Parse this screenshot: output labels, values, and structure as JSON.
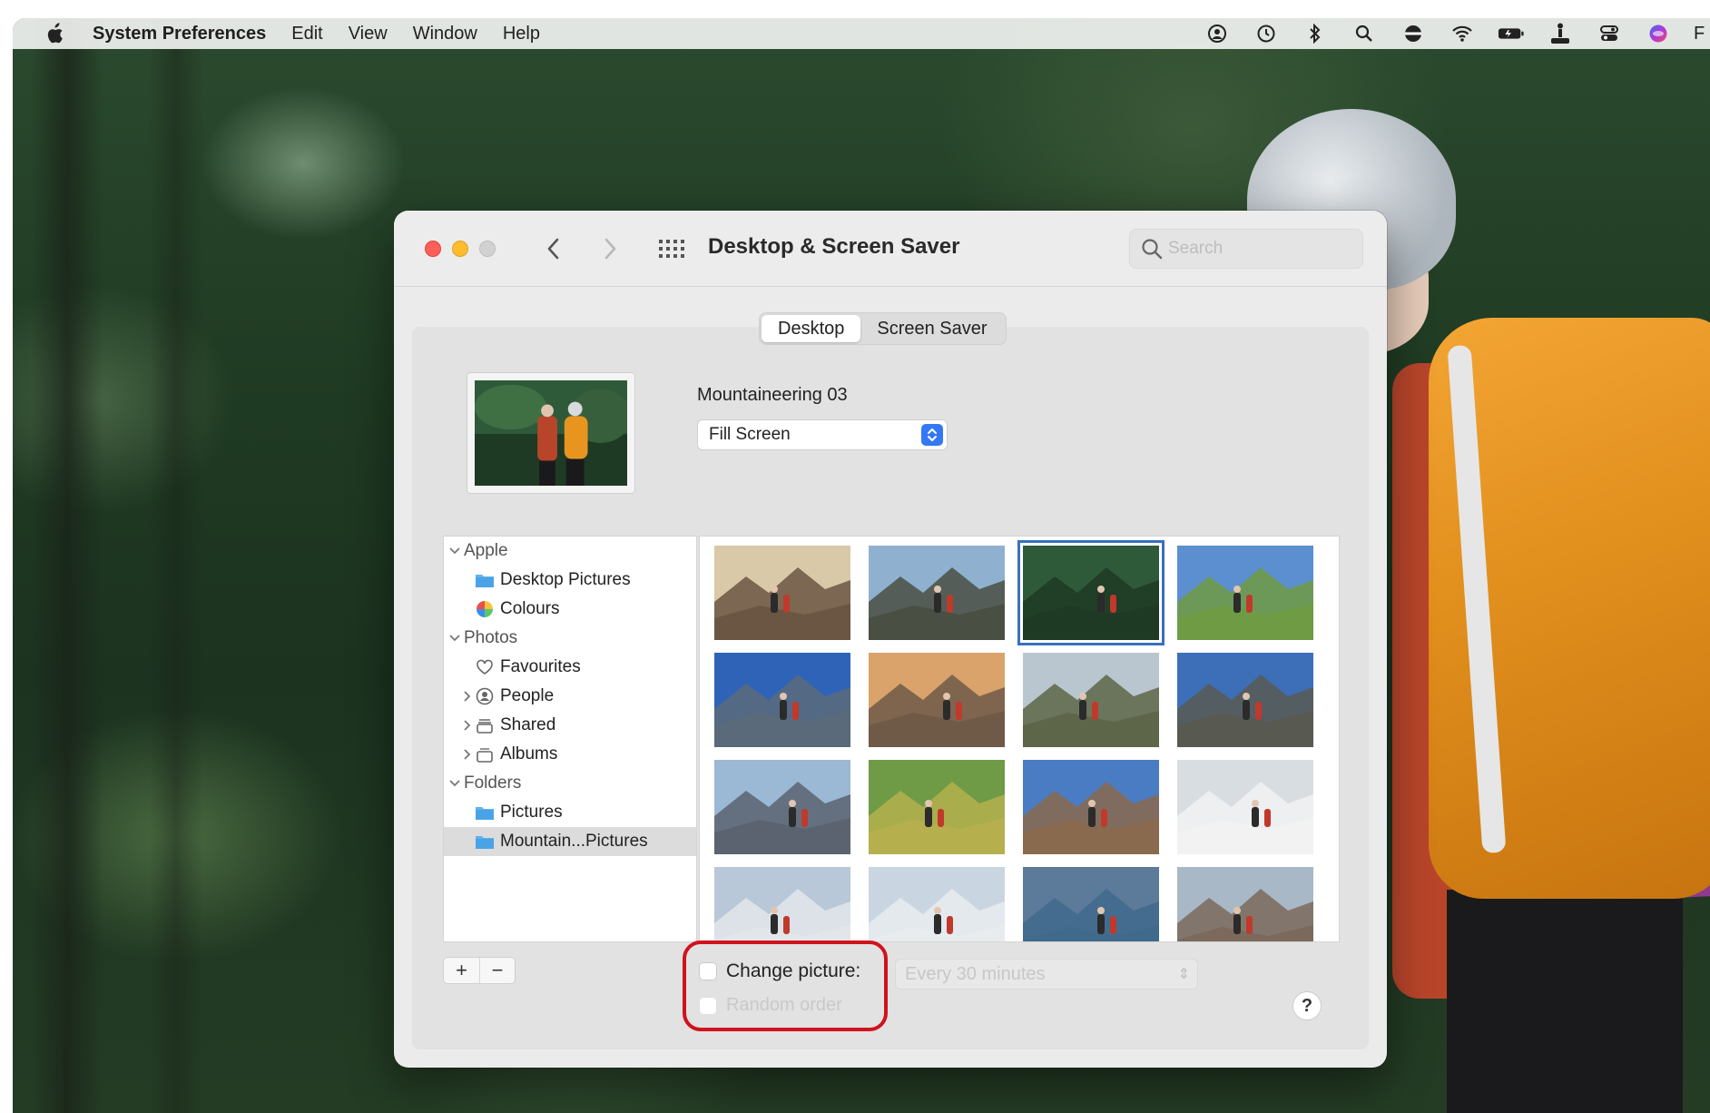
{
  "menubar": {
    "app_name": "System Preferences",
    "items": [
      "Edit",
      "View",
      "Window",
      "Help"
    ],
    "status_icons": [
      "user-switch-icon",
      "time-machine-icon",
      "bluetooth-icon",
      "spotlight-icon",
      "vpn-icon",
      "wifi-icon",
      "battery-icon",
      "accessibility-icon",
      "control-center-icon",
      "siri-icon"
    ],
    "clipped_text": "F"
  },
  "window": {
    "title": "Desktop & Screen Saver",
    "search_placeholder": "Search",
    "tabs": [
      {
        "label": "Desktop",
        "active": true
      },
      {
        "label": "Screen Saver",
        "active": false
      }
    ],
    "wallpaper_name": "Mountaineering 03",
    "fill_mode": "Fill Screen"
  },
  "sources": [
    {
      "label": "Apple",
      "kind": "group",
      "expanded": true
    },
    {
      "label": "Desktop Pictures",
      "kind": "folder",
      "icon": "folder-icon"
    },
    {
      "label": "Colours",
      "kind": "item",
      "icon": "colour-wheel-icon"
    },
    {
      "label": "Photos",
      "kind": "group",
      "expanded": true
    },
    {
      "label": "Favourites",
      "kind": "item",
      "icon": "heart-icon"
    },
    {
      "label": "People",
      "kind": "item",
      "icon": "person-icon",
      "collapsed": true
    },
    {
      "label": "Shared",
      "kind": "item",
      "icon": "shared-album-icon",
      "collapsed": true
    },
    {
      "label": "Albums",
      "kind": "item",
      "icon": "album-icon",
      "collapsed": true
    },
    {
      "label": "Folders",
      "kind": "group",
      "expanded": true
    },
    {
      "label": "Pictures",
      "kind": "folder",
      "icon": "folder-icon"
    },
    {
      "label": "Mountain...Pictures",
      "kind": "folder",
      "icon": "folder-icon",
      "selected": true
    }
  ],
  "controls": {
    "add": "+",
    "remove": "−",
    "change_picture_label": "Change picture:",
    "change_picture_checked": false,
    "random_order_label": "Random order",
    "random_order_enabled": false,
    "interval": "Every 30 minutes",
    "help": "?"
  },
  "thumbnails": [
    {
      "name": "mountaineering-01",
      "sky": "#d9c9a8",
      "ground": "#6b5643",
      "selected": false
    },
    {
      "name": "mountaineering-02",
      "sky": "#8fb1cf",
      "ground": "#4a4f43",
      "selected": false
    },
    {
      "name": "mountaineering-03",
      "sky": "#2f5a3a",
      "ground": "#1f3a24",
      "selected": true
    },
    {
      "name": "mountaineering-04",
      "sky": "#5c8fd0",
      "ground": "#6e9b43",
      "selected": false
    },
    {
      "name": "mountaineering-05",
      "sky": "#2f63b8",
      "ground": "#5a6a7a",
      "selected": false
    },
    {
      "name": "mountaineering-06",
      "sky": "#d9a36b",
      "ground": "#6f5a48",
      "selected": false
    },
    {
      "name": "mountaineering-07",
      "sky": "#b9c6cf",
      "ground": "#5d6648",
      "selected": false
    },
    {
      "name": "mountaineering-08",
      "sky": "#3d6fb8",
      "ground": "#585a52",
      "selected": false
    },
    {
      "name": "mountaineering-09",
      "sky": "#9bb9d4",
      "ground": "#5b6370",
      "selected": false
    },
    {
      "name": "mountaineering-10",
      "sky": "#6f9a46",
      "ground": "#b5b04d",
      "selected": false
    },
    {
      "name": "mountaineering-11",
      "sky": "#4a7cc4",
      "ground": "#8a6a4e",
      "selected": false
    },
    {
      "name": "mountaineering-12",
      "sky": "#d8dde2",
      "ground": "#f2f2f2",
      "selected": false
    },
    {
      "name": "mountaineering-13",
      "sky": "#b8c8d8",
      "ground": "#e2e6ea",
      "selected": false
    },
    {
      "name": "mountaineering-14",
      "sky": "#c9d6e2",
      "ground": "#e8ecef",
      "selected": false
    },
    {
      "name": "mountaineering-15",
      "sky": "#5c7a9a",
      "ground": "#3f6a8c",
      "selected": false
    },
    {
      "name": "mountaineering-16",
      "sky": "#a9b8c6",
      "ground": "#7b6a5c",
      "selected": false
    }
  ],
  "colors": {
    "accent": "#3478f6",
    "highlight_ring": "#d0121d",
    "close": "#fe5f57",
    "minimize": "#febc2e"
  }
}
